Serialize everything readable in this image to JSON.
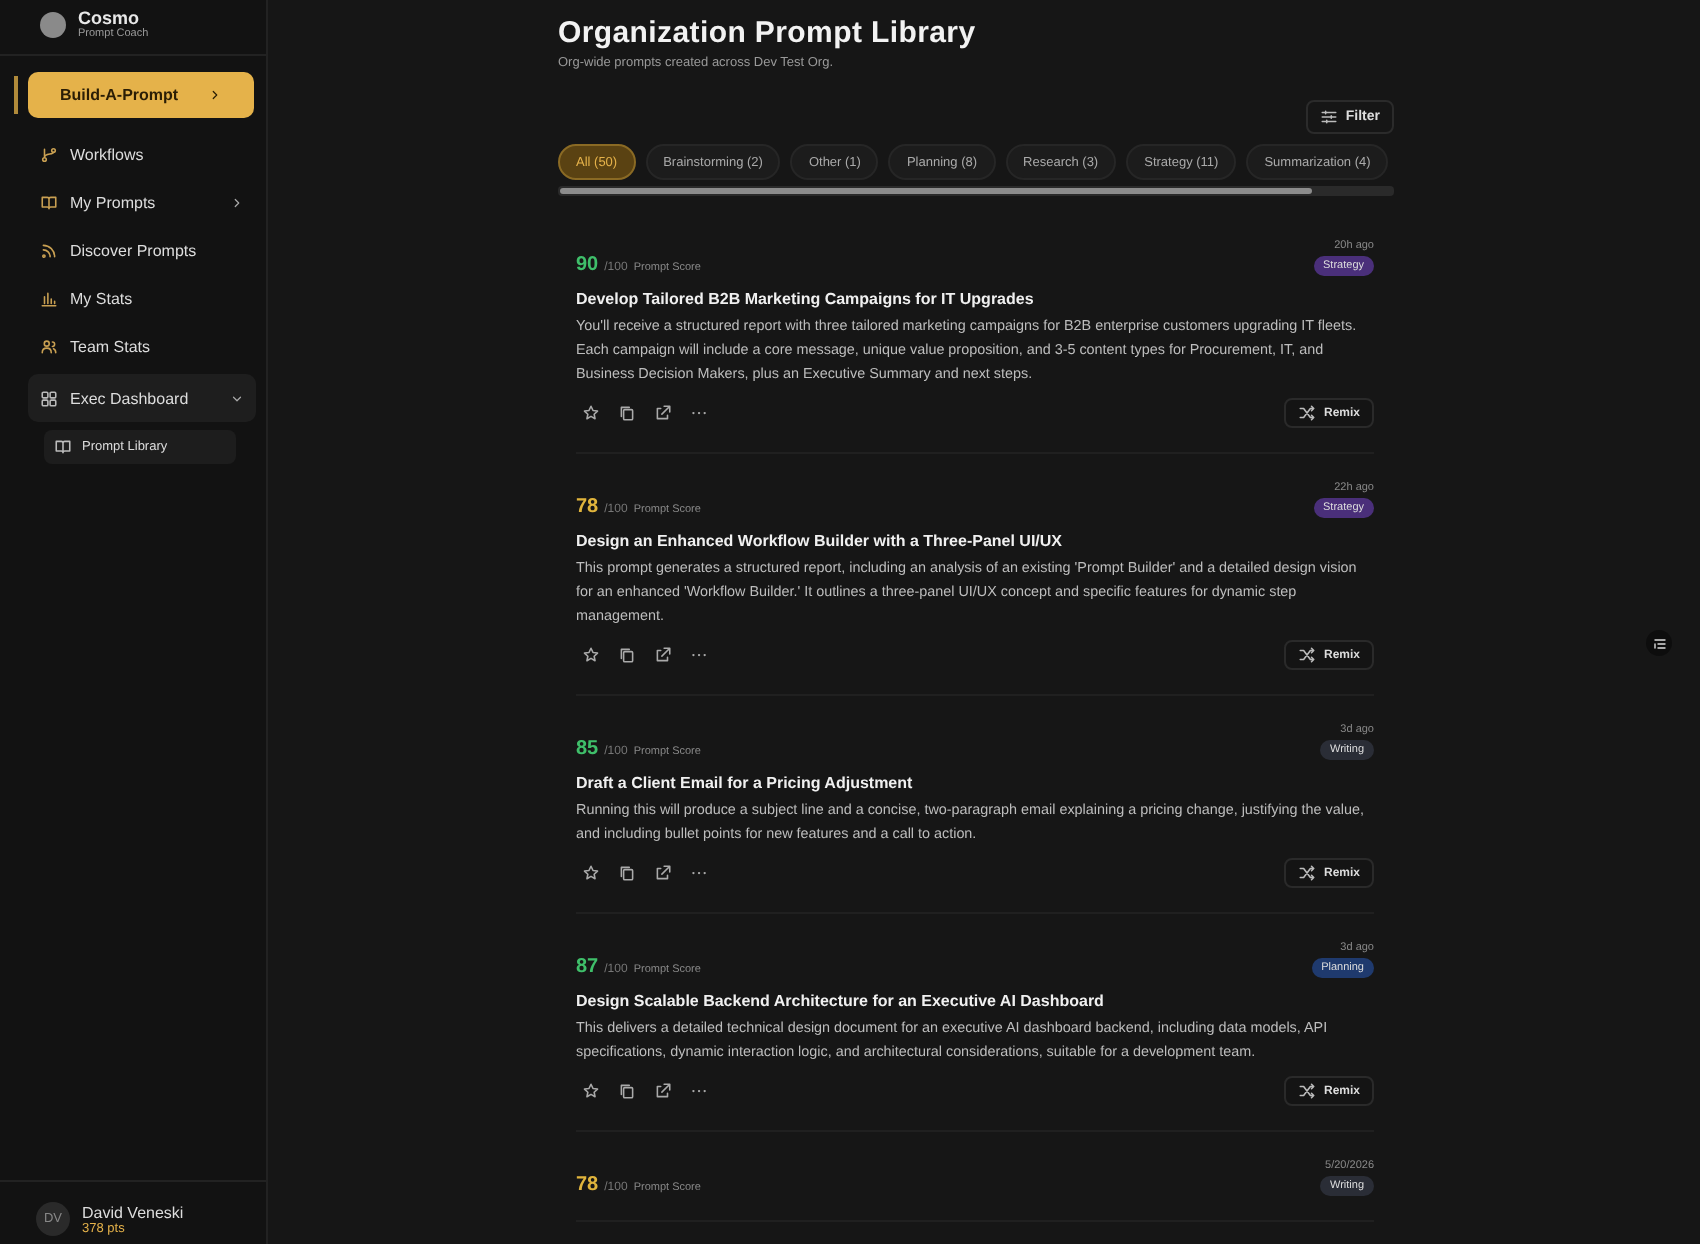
{
  "brand": {
    "name": "Cosmo",
    "tagline": "Prompt Coach"
  },
  "nav": [
    {
      "label": "Build-A-Prompt",
      "kind": "primary"
    },
    {
      "label": "Workflows",
      "kind": "link"
    },
    {
      "label": "My Prompts",
      "kind": "submenu"
    },
    {
      "label": "Discover Prompts",
      "kind": "link"
    },
    {
      "label": "My Stats",
      "kind": "link"
    },
    {
      "label": "Team Stats",
      "kind": "link"
    },
    {
      "label": "Exec Dashboard",
      "kind": "group",
      "expanded": true,
      "children": [
        {
          "label": "Prompt Library",
          "selected": true
        }
      ]
    }
  ],
  "user": {
    "initials": "DV",
    "name": "David Veneski",
    "points": "378 pts"
  },
  "page": {
    "title": "Organization Prompt Library",
    "subtitle": "Org-wide prompts created across Dev Test Org.",
    "filter_button": "Filter"
  },
  "categories": [
    {
      "label": "All (50)",
      "selected": true
    },
    {
      "label": "Brainstorming (2)",
      "selected": false
    },
    {
      "label": "Other (1)",
      "selected": false
    },
    {
      "label": "Planning (8)",
      "selected": false
    },
    {
      "label": "Research (3)",
      "selected": false
    },
    {
      "label": "Strategy (11)",
      "selected": false
    },
    {
      "label": "Summarization (4)",
      "selected": false
    }
  ],
  "prompts": [
    {
      "time": "20h ago",
      "score": {
        "value": "90",
        "color": "#3fbf6a"
      },
      "max": "/100",
      "score_label": "Prompt Score",
      "tag": {
        "label": "Strategy",
        "color": "#4a2f7a"
      },
      "title": "Develop Tailored B2B Marketing Campaigns for IT Upgrades",
      "description": "You'll receive a structured report with three tailored marketing campaigns for B2B enterprise customers upgrading IT fleets. Each campaign will include a core message, unique value proposition, and 3-5 content types for Procurement, IT, and Business Decision Makers, plus an Executive Summary and next steps.",
      "action": "Remix"
    },
    {
      "time": "22h ago",
      "score": {
        "value": "78",
        "color": "#e0b43c"
      },
      "max": "/100",
      "score_label": "Prompt Score",
      "tag": {
        "label": "Strategy",
        "color": "#4a2f7a"
      },
      "title": "Design an Enhanced Workflow Builder with a Three-Panel UI/UX",
      "description": "This prompt generates a structured report, including an analysis of an existing 'Prompt Builder' and a detailed design vision for an enhanced 'Workflow Builder.' It outlines a three-panel UI/UX concept and specific features for dynamic step management.",
      "action": "Remix"
    },
    {
      "time": "3d ago",
      "score": {
        "value": "85",
        "color": "#3fbf6a"
      },
      "max": "/100",
      "score_label": "Prompt Score",
      "tag": {
        "label": "Writing",
        "color": "#2a2d36"
      },
      "title": "Draft a Client Email for a Pricing Adjustment",
      "description": "Running this will produce a subject line and a concise, two-paragraph email explaining a pricing change, justifying the value, and including bullet points for new features and a call to action.",
      "action": "Remix"
    },
    {
      "time": "3d ago",
      "score": {
        "value": "87",
        "color": "#3fbf6a"
      },
      "max": "/100",
      "score_label": "Prompt Score",
      "tag": {
        "label": "Planning",
        "color": "#1f3a6e"
      },
      "title": "Design Scalable Backend Architecture for an Executive AI Dashboard",
      "description": "This delivers a detailed technical design document for an executive AI dashboard backend, including data models, API specifications, dynamic interaction logic, and architectural considerations, suitable for a development team.",
      "action": "Remix"
    },
    {
      "time": "5/20/2026",
      "score": {
        "value": "78",
        "color": "#e0b43c"
      },
      "max": "/100",
      "score_label": "Prompt Score",
      "tag": {
        "label": "Writing",
        "color": "#2a2d36"
      }
    }
  ]
}
